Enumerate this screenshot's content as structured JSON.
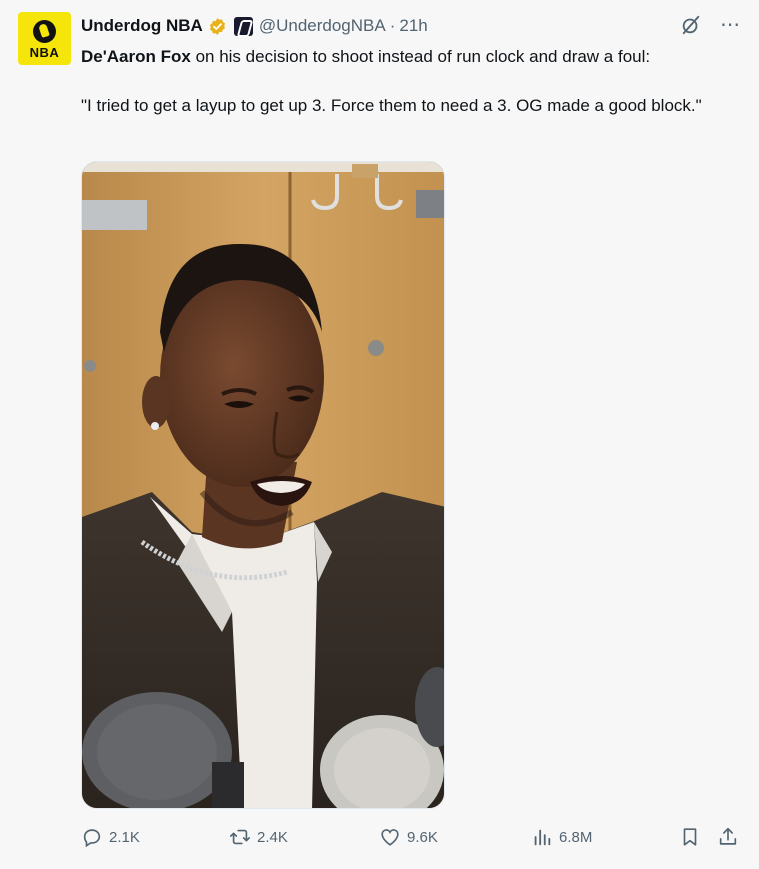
{
  "account": {
    "name": "Underdog NBA",
    "handle": "@UnderdogNBA",
    "separator": "·",
    "time": "21h",
    "avatar_label": "NBA"
  },
  "tweet": {
    "bold_name": "De'Aaron Fox",
    "line1_rest": " on his decision to shoot instead of run clock and draw a foul:",
    "quote": "\"I tried to get a layup to get up 3. Force them to need a 3. OG made a good block.\""
  },
  "actions": {
    "replies": "2.1K",
    "retweets": "2.4K",
    "likes": "9.6K",
    "views": "6.8M"
  },
  "icons": {
    "verified": "verified-badge-icon",
    "affiliate": "affiliate-badge-icon",
    "grok": "grok-icon",
    "more": "more-icon",
    "reply": "reply-icon",
    "retweet": "retweet-icon",
    "like": "heart-icon",
    "views": "views-icon",
    "bookmark": "bookmark-icon",
    "share": "share-icon"
  },
  "colors": {
    "accent_yellow": "#f5e50a",
    "muted_text": "#536471",
    "verified_gold": "#e8b21b"
  }
}
